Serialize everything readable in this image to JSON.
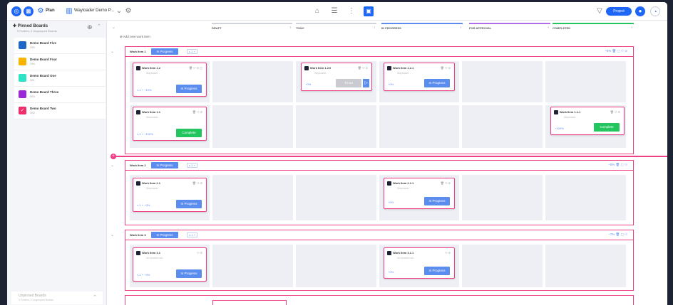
{
  "topbar": {
    "plan_label": "Plan",
    "project_name": "Wayloader Demo P...",
    "project_button": "Project",
    "view_icons": [
      "home-icon",
      "list-icon",
      "tree-icon",
      "board-icon"
    ]
  },
  "sidebar": {
    "pinned_title": "Pinned Boards",
    "pinned_sub": "5 Folders, 0 Ungrouped Boards",
    "boards": [
      {
        "name": "Demo Board Five",
        "sub": "DB5",
        "color": "#1e66c8"
      },
      {
        "name": "Demo Board Four",
        "sub": "DB4",
        "color": "#f7b500"
      },
      {
        "name": "Demo Board One",
        "sub": "DB1",
        "color": "#2ee3c6"
      },
      {
        "name": "Demo Board Three",
        "sub": "DB3",
        "color": "#9b2ad6"
      },
      {
        "name": "Demo Board Two",
        "sub": "DB2",
        "color": "#ef2d6b"
      }
    ],
    "unpinned_title": "Unpinned Boards",
    "unpinned_sub": "0 Folders, 0 Ungrouped Boards"
  },
  "board": {
    "add_work_item": "Add new work item",
    "columns": [
      {
        "label": "DRAFT",
        "color": "#d0d3da"
      },
      {
        "label": "TODO",
        "color": "#d0d3da"
      },
      {
        "label": "IN PROGRESS",
        "color": "#5b8def"
      },
      {
        "label": "FOR APPROVAL",
        "color": "#b06ee6"
      },
      {
        "label": "COMPLETED",
        "color": "#22c55e"
      }
    ],
    "swimlanes": [
      {
        "title": "Work Item 1",
        "status": "In Progress",
        "count": "1",
        "progress": "0%"
      },
      {
        "title": "Work Item 2",
        "status": "In Progress",
        "count": "1",
        "progress": "0%"
      },
      {
        "title": "Work Item 3",
        "status": "In Progress",
        "count": "1",
        "progress": "7%"
      }
    ],
    "cards": [
      {
        "title": "Work Item 1.2",
        "sub": "Wayloader...",
        "progress": "10%",
        "status": "In Progress"
      },
      {
        "title": "Work Item 1.2.0",
        "sub": "Wayloader...",
        "progress": "0%",
        "status": "To Do"
      },
      {
        "title": "Work Item 1.2.1",
        "sub": "Wayloader...",
        "progress": "0%",
        "status": "In Progress"
      },
      {
        "title": "Work Item 1.1",
        "sub": "Wayloader...",
        "progress": "100%",
        "status": "Complete"
      },
      {
        "title": "Work Item 1.1.1",
        "sub": "Wayloader...",
        "progress": "100%",
        "status": "Complete"
      },
      {
        "title": "Work Item 2.1",
        "sub": "Wayloader...",
        "progress": "0%",
        "status": "In Progress"
      },
      {
        "title": "Work Item 2.1.1",
        "sub": "Wayloader...",
        "progress": "0%",
        "status": "In Progress"
      },
      {
        "title": "Work Item 3.1",
        "sub": "No location set...",
        "progress": "0%",
        "status": "In Progress"
      },
      {
        "title": "Work Item 3.1.1",
        "sub": "No location set...",
        "progress": "0%",
        "status": "In Progress"
      }
    ]
  }
}
